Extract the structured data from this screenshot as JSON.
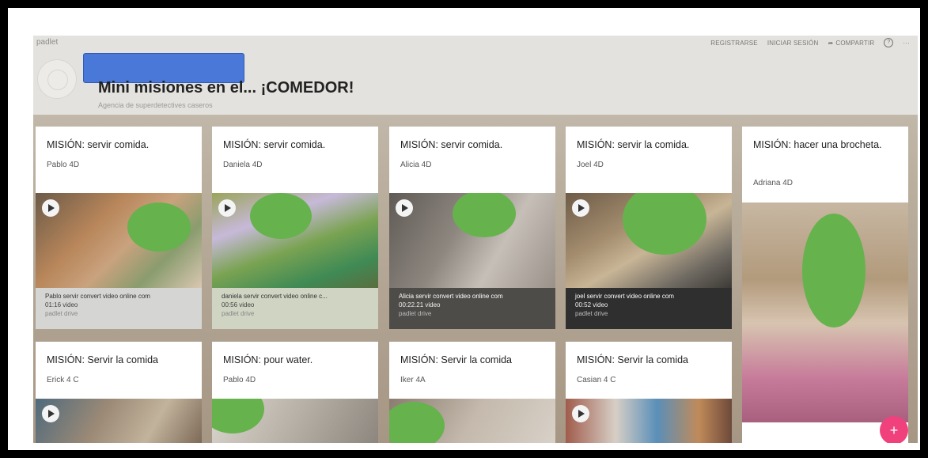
{
  "header": {
    "brand": "padlet",
    "nav": {
      "register": "REGISTRARSE",
      "login": "INICIAR SESIÓN",
      "share": "COMPARTIR",
      "help": "?",
      "more": "···"
    },
    "title": "Mini misiones en el... ¡COMEDOR!",
    "subtitle": "Agencia de superdetectives caseros"
  },
  "cards": [
    {
      "title": "MISIÓN: servir comida.",
      "author": "Pablo 4D",
      "caption": {
        "line1": "Pablo servir convert video online com",
        "line2": "01:16 video",
        "line3": "padlet drive"
      }
    },
    {
      "title": "MISIÓN: servir comida.",
      "author": "Daniela 4D",
      "caption": {
        "line1": "daniela servir convert video online c...",
        "line2": "00:56 video",
        "line3": "padlet drive"
      }
    },
    {
      "title": "MISIÓN: servir comida.",
      "author": "Alicia 4D",
      "caption": {
        "line1": "Alicia servir convert video online com",
        "line2": "00:22.21 video",
        "line3": "padlet drive"
      }
    },
    {
      "title": "MISIÓN: servir la comida.",
      "author": "Joel 4D",
      "caption": {
        "line1": "joel servir convert video online com",
        "line2": "00:52 video",
        "line3": "padlet drive"
      }
    },
    {
      "title": "MISIÓN: hacer una brocheta.",
      "author": "Adriana 4D"
    },
    {
      "title": "MISIÓN: Servir la comida",
      "author": "Erick 4 C"
    },
    {
      "title": "MISIÓN: pour water.",
      "author": "Pablo 4D"
    },
    {
      "title": "MISIÓN: Servir la comida",
      "author": "Iker 4A"
    },
    {
      "title": "MISIÓN: Servir la comida",
      "author": "Casian 4 C"
    }
  ],
  "fab": "+",
  "colors": {
    "accent_pink": "#f0417d",
    "redaction_green": "#66b24d",
    "redaction_blue": "#4a78d8"
  }
}
